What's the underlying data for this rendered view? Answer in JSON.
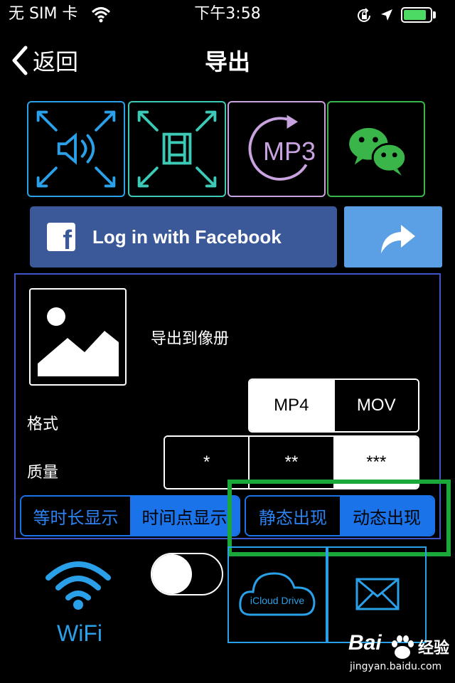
{
  "status_bar": {
    "carrier": "无 SIM 卡",
    "time": "下午3:58",
    "battery_level": 0.85,
    "icons": [
      "wifi-icon",
      "rotation-lock-icon",
      "location-arrow-icon",
      "battery-icon"
    ]
  },
  "nav": {
    "back_label": "返回",
    "title": "导出"
  },
  "export_icons": [
    {
      "name": "audio-export",
      "color": "#2aa0e8"
    },
    {
      "name": "video-export",
      "color": "#3cc9b6"
    },
    {
      "name": "mp3-export",
      "label": "MP3",
      "color": "#c9a3e0"
    },
    {
      "name": "wechat-share",
      "color": "#3ab54a"
    }
  ],
  "facebook": {
    "label": "Log in with Facebook",
    "logo_letter": "f",
    "color": "#3b5998"
  },
  "share_color": "#5b9fe4",
  "panel": {
    "export_album_label": "导出到像册",
    "format_label": "格式",
    "quality_label": "质量",
    "format_options": [
      "MP4",
      "MOV"
    ],
    "format_selected": "MP4",
    "quality_options": [
      "*",
      "**",
      "***"
    ],
    "quality_selected": "***",
    "display_mode": {
      "options": [
        "等时长显示",
        "时间点显示"
      ],
      "selected": "时间点显示"
    },
    "appear_mode": {
      "options": [
        "静态出现",
        "动态出现"
      ],
      "selected": "动态出现"
    }
  },
  "bottom": {
    "wifi_label": "WiFi",
    "toggle_on": false,
    "icloud_label": "iCloud Drive",
    "mail_icon": "mail-icon"
  },
  "highlight_color": "#1aa83a",
  "watermark": {
    "brand": "Bai",
    "brand_suffix": "经验",
    "url": "jingyan.baidu.com"
  }
}
